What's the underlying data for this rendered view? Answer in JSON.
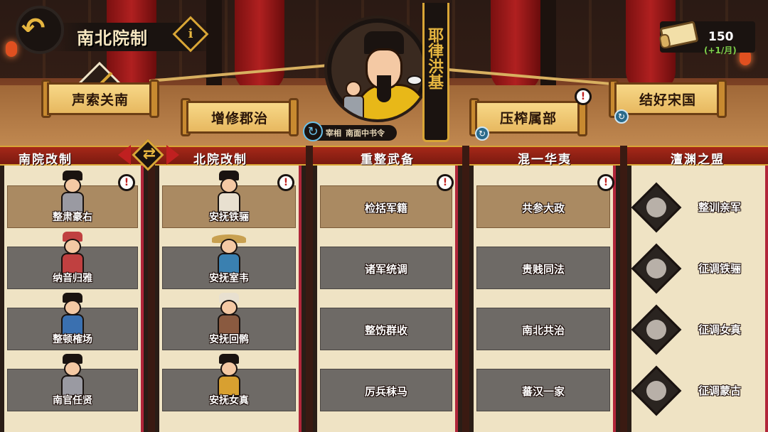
{
  "header": {
    "back_label": "back",
    "title": "南北院制",
    "info_symbol": "i",
    "currency": {
      "value": "150",
      "rate": "(+1/月)"
    }
  },
  "policies_top": [
    {
      "label": "声索关南"
    },
    {
      "label": "增修郡治"
    },
    {
      "label": "压榨属部"
    },
    {
      "label": "结好宋国"
    }
  ],
  "minister": {
    "name": "耶律洪基",
    "role": "宰相",
    "office": "南面中书令"
  },
  "columns": [
    {
      "title": "南院改制",
      "items": [
        {
          "label": "整肃豪右",
          "active": true,
          "robe": "#9a9aa2"
        },
        {
          "label": "纳音归雅",
          "active": false,
          "robe": "#c04040"
        },
        {
          "label": "整顿榷场",
          "active": false,
          "robe": "#3a70b0"
        },
        {
          "label": "南官任贤",
          "active": false,
          "robe": "#9a9aa2"
        }
      ]
    },
    {
      "title": "北院改制",
      "items": [
        {
          "label": "安抚铁骊",
          "active": true,
          "robe": "#e8e0d0"
        },
        {
          "label": "安抚室韦",
          "active": false,
          "robe": "#3a80b0"
        },
        {
          "label": "安抚回鹘",
          "active": false,
          "robe": "#8a5a40"
        },
        {
          "label": "安抚女真",
          "active": false,
          "robe": "#d8a030"
        }
      ]
    },
    {
      "title": "重整武备",
      "items": [
        {
          "label": "检括军籍",
          "active": true
        },
        {
          "label": "诸军统调",
          "active": false
        },
        {
          "label": "整饬群收",
          "active": false
        },
        {
          "label": "厉兵秣马",
          "active": false
        }
      ]
    },
    {
      "title": "混一华夷",
      "items": [
        {
          "label": "共参大政",
          "active": true
        },
        {
          "label": "贵贱同法",
          "active": false
        },
        {
          "label": "南北共治",
          "active": false
        },
        {
          "label": "蕃汉一家",
          "active": false
        }
      ]
    },
    {
      "title": "澶渊之盟",
      "items": [
        {
          "label": "整训亲军"
        },
        {
          "label": "征调铁骊"
        },
        {
          "label": "征调女真"
        },
        {
          "label": "征调蒙古"
        }
      ]
    }
  ],
  "colors": {
    "gold": "#d9a636",
    "red": "#a62818",
    "active_cell": "#aa8a62",
    "inactive_cell": "#6e6a66"
  },
  "icons": [
    "back-arrow-icon",
    "info-icon",
    "scroll-currency-icon",
    "refresh-icon",
    "alert-icon",
    "sword-icon",
    "switch-arrow-icon",
    "emblem-icon"
  ]
}
